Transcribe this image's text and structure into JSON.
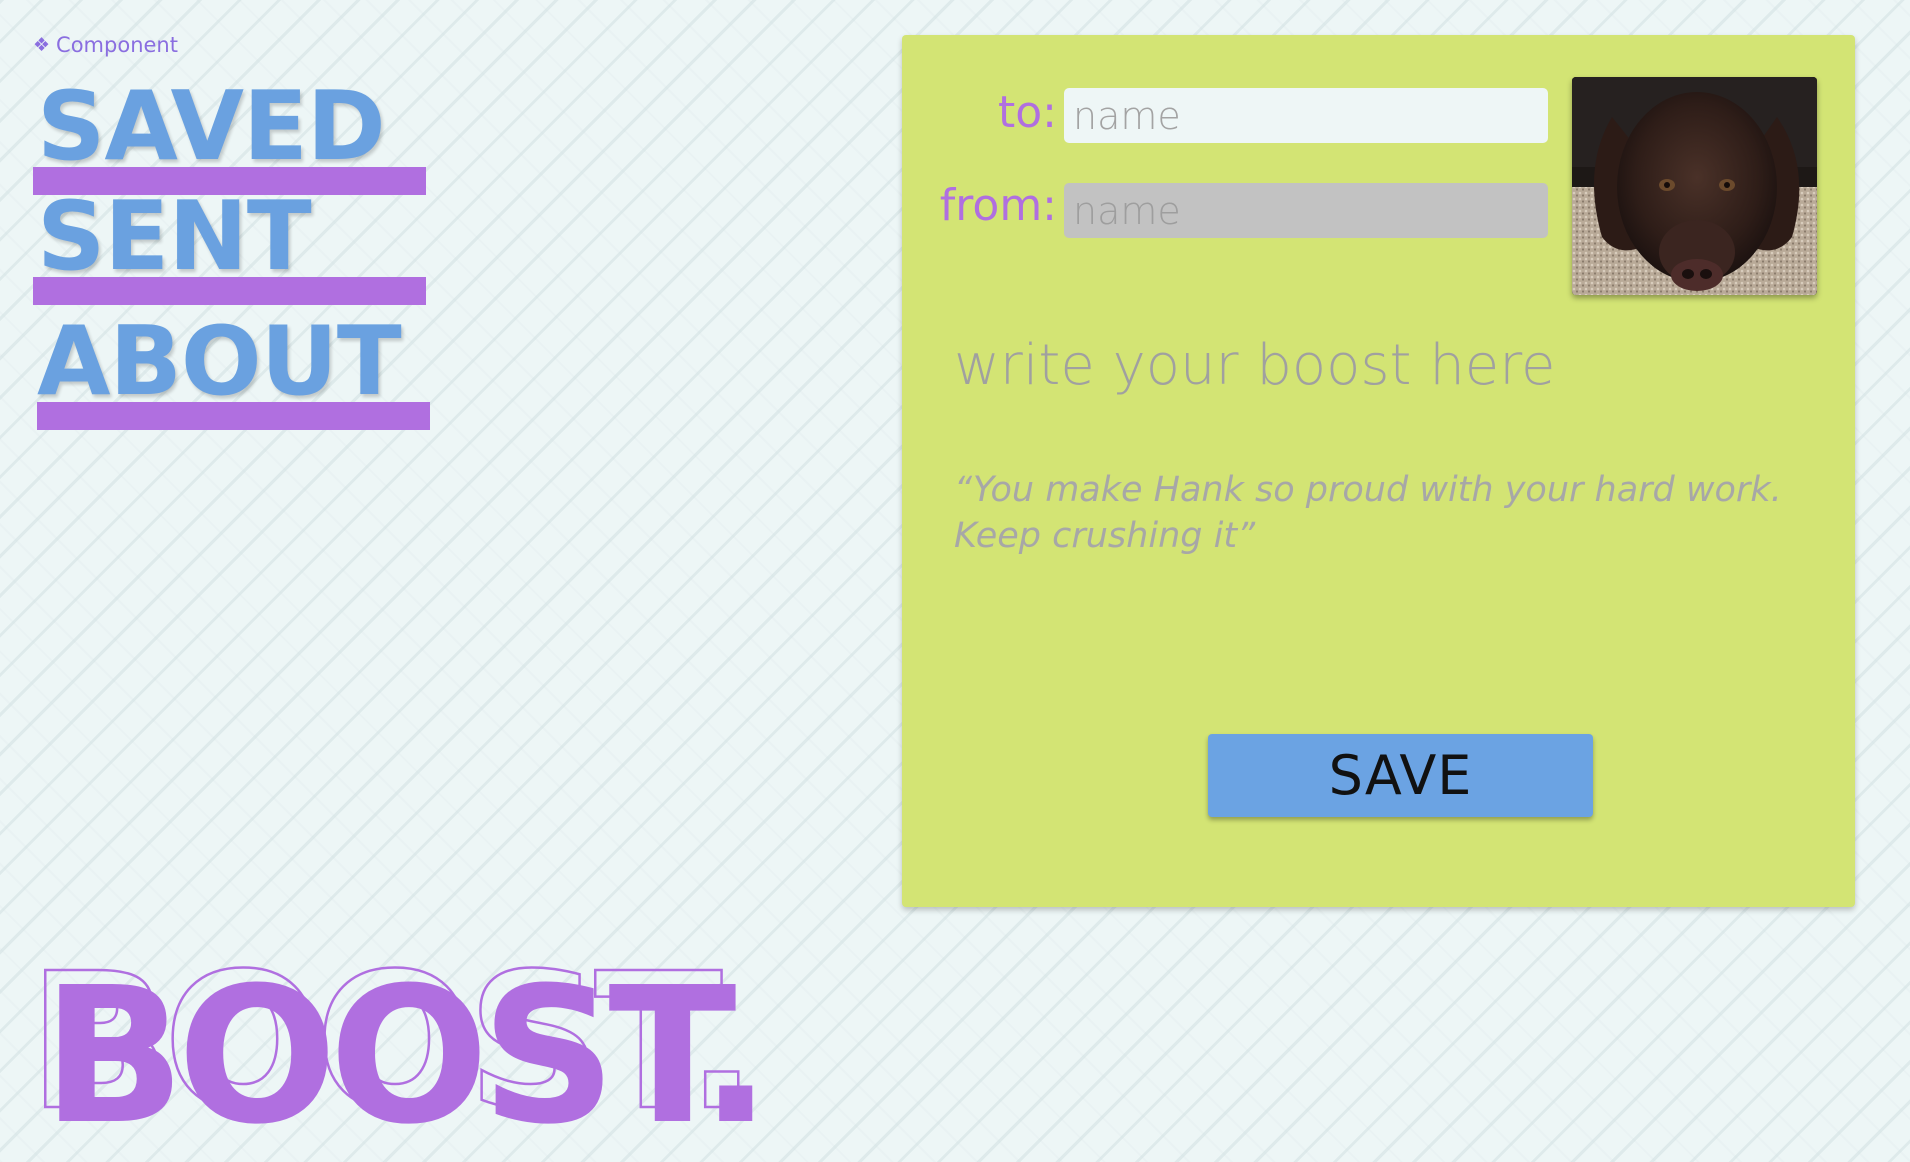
{
  "component_tag": {
    "icon": "component-diamond-icon",
    "symbol": "❖",
    "label": "Component"
  },
  "nav": {
    "items": [
      {
        "label": "SAVED"
      },
      {
        "label": "SENT"
      },
      {
        "label": "ABOUT"
      }
    ]
  },
  "logo": {
    "text": "BOOST."
  },
  "form": {
    "to_label": "to:",
    "to_placeholder": "name",
    "from_label": "from:",
    "from_placeholder": "name",
    "boost_placeholder": "write your boost here",
    "example_line1": "“You make Hank so proud with your hard work.",
    "example_line2": "Keep crushing it”",
    "save_label": "SAVE",
    "photo_alt": "dog photo"
  },
  "colors": {
    "background": "#edf6f6",
    "accent_purple": "#b06fe0",
    "nav_blue": "#6aa1e0",
    "card_green": "#d3e474",
    "button_blue": "#6ba3e3"
  }
}
